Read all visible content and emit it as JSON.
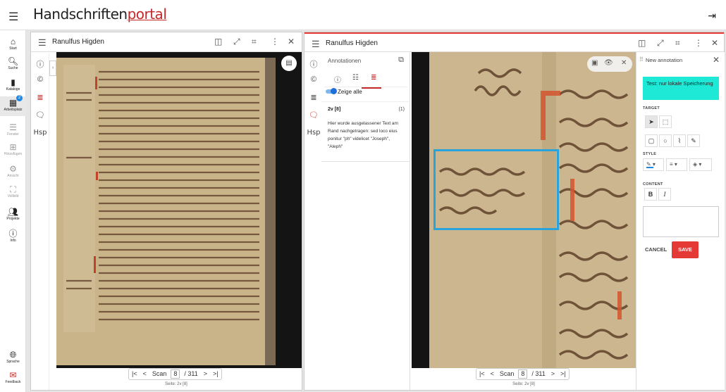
{
  "app": {
    "logo_main": "Handschriften",
    "logo_accent": "portal",
    "colors": {
      "accent": "#c62828",
      "highlight": "#29a3d9",
      "notice": "#1de9d6",
      "save": "#e53935"
    }
  },
  "nav": {
    "items": [
      {
        "label": "Start",
        "icon": "home-icon"
      },
      {
        "label": "Suche",
        "icon": "search-icon"
      },
      {
        "label": "Kataloge",
        "icon": "book-icon"
      },
      {
        "label": "Arbeitsplatz",
        "icon": "workspace-icon",
        "badge": "2"
      },
      {
        "label": "Fenster",
        "icon": "window-list-icon"
      },
      {
        "label": "Hinzufügen",
        "icon": "add-icon"
      },
      {
        "label": "Ansicht",
        "icon": "gear-icon"
      },
      {
        "label": "Vollbild",
        "icon": "fullscreen-icon"
      },
      {
        "label": "Projekte",
        "icon": "people-icon"
      },
      {
        "label": "Info",
        "icon": "info-icon"
      }
    ],
    "sprache": "Sprache",
    "feedback": "Feedback"
  },
  "window1": {
    "title": "Ranulfus Higden",
    "pager": {
      "scan_label": "Scan",
      "page": "8",
      "total": "/ 311"
    },
    "caption": "Seite: 2v [8]"
  },
  "window2": {
    "title": "Ranulfus Higden",
    "pager": {
      "scan_label": "Scan",
      "page": "8",
      "total": "/ 311"
    },
    "caption": "Seite: 2v [8]"
  },
  "annotations": {
    "header": "Annotationen",
    "toggle_label": "Zeige alle",
    "item": {
      "ref": "2v [8]",
      "count": "(1)",
      "text": "Hier wurde ausgelassener Text am Rand nachgetragen: sed loco eius ponitur \"ph\" videlicet \"Joseph\", \"Aleph\""
    }
  },
  "new_annotation": {
    "header": "New annotation",
    "notice": "Test: nur lokale Speicherung",
    "target_label": "TARGET",
    "style_label": "STYLE",
    "content_label": "CONTENT",
    "bold": "B",
    "italic": "I",
    "cancel": "CANCEL",
    "save": "SAVE"
  },
  "side": {
    "hsp": "Hsp"
  }
}
